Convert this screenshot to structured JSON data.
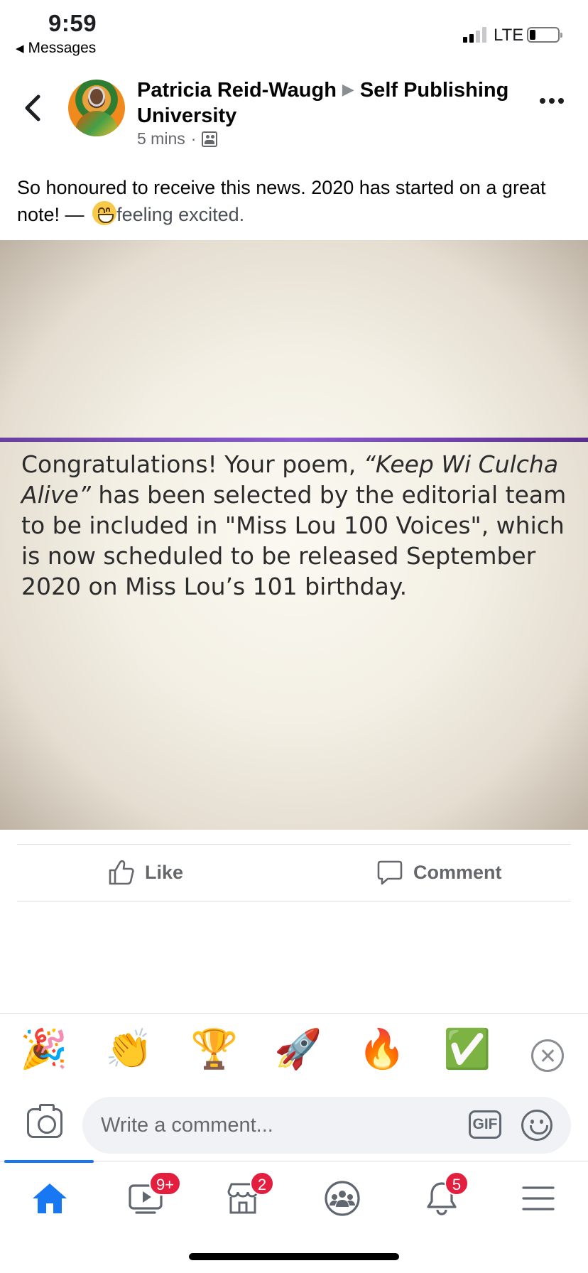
{
  "status_bar": {
    "time": "9:59",
    "back_app": "Messages",
    "network": "LTE"
  },
  "post": {
    "author": "Patricia Reid-Waugh",
    "group": "Self Publishing University",
    "timestamp": "5 mins",
    "meta_separator": "·",
    "text": "So honoured to receive this news. 2020 has started on a great note! — ",
    "feeling": "feeling excited.",
    "image_text": {
      "line_start": "Congratulations!  Your poem, ",
      "poem_title": "“Keep Wi Culcha Alive”",
      "line_rest": " has been selected by the editorial team to be included in \"Miss Lou 100 Voices\", which is now scheduled to be released September 2020 on Miss Lou’s 101 birthday."
    }
  },
  "actions": {
    "like_label": "Like",
    "comment_label": "Comment"
  },
  "quick_reactions": [
    "🎉",
    "👏",
    "🏆",
    "🚀",
    "🔥",
    "✅"
  ],
  "composer": {
    "placeholder": "Write a comment...",
    "gif_label": "GIF"
  },
  "tab_bar": {
    "tabs": [
      {
        "name": "home",
        "badge": ""
      },
      {
        "name": "watch",
        "badge": "9+"
      },
      {
        "name": "marketplace",
        "badge": "2"
      },
      {
        "name": "groups",
        "badge": ""
      },
      {
        "name": "notifications",
        "badge": "5"
      },
      {
        "name": "menu",
        "badge": ""
      }
    ]
  },
  "colors": {
    "accent": "#1877f2",
    "badge": "#e41e3f",
    "secondary_text": "#65676b",
    "banner_band": "#6a3fa0"
  }
}
